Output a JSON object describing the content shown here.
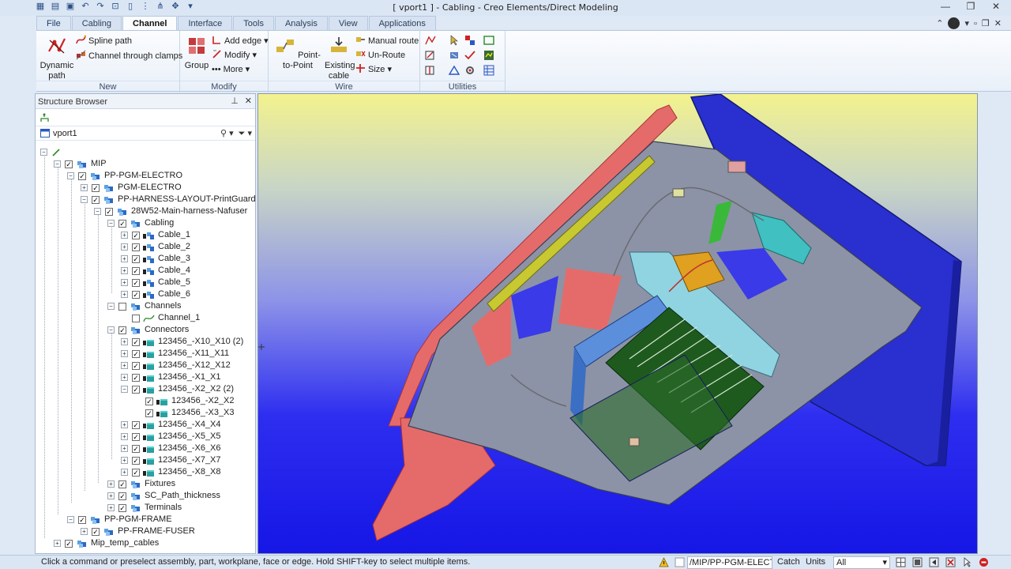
{
  "window": {
    "title": "[ vport1 ] - Cabling - Creo Elements/Direct Modeling"
  },
  "ribbon": {
    "tabs": [
      {
        "label": "File"
      },
      {
        "label": "Cabling"
      },
      {
        "label": "Channel"
      },
      {
        "label": "Interface"
      },
      {
        "label": "Tools"
      },
      {
        "label": "Analysis"
      },
      {
        "label": "View"
      },
      {
        "label": "Applications"
      }
    ],
    "active_tab": "Channel",
    "groups": {
      "new": {
        "label": "New",
        "dynamic_path": "Dynamic path",
        "spline_path": "Spline path",
        "channel_through_clamps": "Channel through clamps"
      },
      "modify": {
        "label": "Modify",
        "group": "Group",
        "add_edge": "Add edge",
        "modify": "Modify",
        "more": "More"
      },
      "wire": {
        "label": "Wire",
        "point_to_point": "Point-to-Point",
        "existing_cable": "Existing cable",
        "manual_route": "Manual route",
        "un_route": "Un-Route",
        "size": "Size"
      },
      "utilities": {
        "label": "Utilities"
      }
    }
  },
  "structure_browser": {
    "title": "Structure Browser",
    "viewport": "vport1",
    "tree": [
      {
        "label": "",
        "level": 0,
        "checked": false,
        "icon": "line-icon"
      },
      {
        "label": "MIP",
        "level": 1,
        "checked": true,
        "icon": "assembly-icon"
      },
      {
        "label": "PP-PGM-ELECTRO",
        "level": 2,
        "checked": true,
        "icon": "assembly-icon"
      },
      {
        "label": "PGM-ELECTRO",
        "level": 3,
        "checked": true,
        "icon": "assembly-icon"
      },
      {
        "label": "PP-HARNESS-LAYOUT-PrintGuard",
        "level": 3,
        "checked": true,
        "icon": "assembly-icon"
      },
      {
        "label": "28W52-Main-harness-Nafuser",
        "level": 4,
        "checked": true,
        "icon": "assembly-icon"
      },
      {
        "label": "Cabling",
        "level": 5,
        "checked": true,
        "icon": "assembly-icon"
      },
      {
        "label": "Cable_1",
        "level": 6,
        "checked": true,
        "icon": "cable-icon"
      },
      {
        "label": "Cable_2",
        "level": 6,
        "checked": true,
        "icon": "cable-icon"
      },
      {
        "label": "Cable_3",
        "level": 6,
        "checked": true,
        "icon": "cable-icon"
      },
      {
        "label": "Cable_4",
        "level": 6,
        "checked": true,
        "icon": "cable-icon"
      },
      {
        "label": "Cable_5",
        "level": 6,
        "checked": true,
        "icon": "cable-icon"
      },
      {
        "label": "Cable_6",
        "level": 6,
        "checked": true,
        "icon": "cable-icon"
      },
      {
        "label": "Channels",
        "level": 5,
        "checked": false,
        "icon": "assembly-icon"
      },
      {
        "label": "Channel_1",
        "level": 6,
        "checked": false,
        "icon": "channel-icon"
      },
      {
        "label": "Connectors",
        "level": 5,
        "checked": true,
        "icon": "assembly-icon"
      },
      {
        "label": "123456_-X10_X10 (2)",
        "level": 6,
        "checked": true,
        "icon": "connector-icon"
      },
      {
        "label": "123456_-X11_X11",
        "level": 6,
        "checked": true,
        "icon": "connector-icon"
      },
      {
        "label": "123456_-X12_X12",
        "level": 6,
        "checked": true,
        "icon": "connector-icon"
      },
      {
        "label": "123456_-X1_X1",
        "level": 6,
        "checked": true,
        "icon": "connector-icon"
      },
      {
        "label": "123456_-X2_X2 (2)",
        "level": 6,
        "checked": true,
        "icon": "connector-icon"
      },
      {
        "label": "123456_-X2_X2",
        "level": 7,
        "checked": true,
        "icon": "connector-icon"
      },
      {
        "label": "123456_-X3_X3",
        "level": 7,
        "checked": true,
        "icon": "connector-icon"
      },
      {
        "label": "123456_-X4_X4",
        "level": 6,
        "checked": true,
        "icon": "connector-icon"
      },
      {
        "label": "123456_-X5_X5",
        "level": 6,
        "checked": true,
        "icon": "connector-icon"
      },
      {
        "label": "123456_-X6_X6",
        "level": 6,
        "checked": true,
        "icon": "connector-icon"
      },
      {
        "label": "123456_-X7_X7",
        "level": 6,
        "checked": true,
        "icon": "connector-icon"
      },
      {
        "label": "123456_-X8_X8",
        "level": 6,
        "checked": true,
        "icon": "connector-icon"
      },
      {
        "label": "Fixtures",
        "level": 5,
        "checked": true,
        "icon": "assembly-icon"
      },
      {
        "label": "SC_Path_thickness",
        "level": 5,
        "checked": true,
        "icon": "assembly-icon"
      },
      {
        "label": "Terminals",
        "level": 5,
        "checked": true,
        "icon": "assembly-icon"
      },
      {
        "label": "PP-PGM-FRAME",
        "level": 2,
        "checked": true,
        "icon": "assembly-icon"
      },
      {
        "label": "PP-FRAME-FUSER",
        "level": 3,
        "checked": true,
        "icon": "assembly-icon"
      },
      {
        "label": "Mip_temp_cables",
        "level": 1,
        "checked": true,
        "icon": "assembly-icon"
      }
    ]
  },
  "status_bar": {
    "message": "Click a command or preselect assembly, part, workplane, face or edge. Hold SHIFT-key to select multiple items.",
    "path": "/MIP/PP-PGM-ELECTRO",
    "catch": "Catch",
    "units": "Units",
    "filter": "All"
  },
  "colors": {
    "viewport_top": "#f3f28e",
    "viewport_bottom": "#1616e6",
    "frame_red": "#e56b6b",
    "sheet_gray": "#8c93a6",
    "panel_blue": "#2a2fd0"
  }
}
